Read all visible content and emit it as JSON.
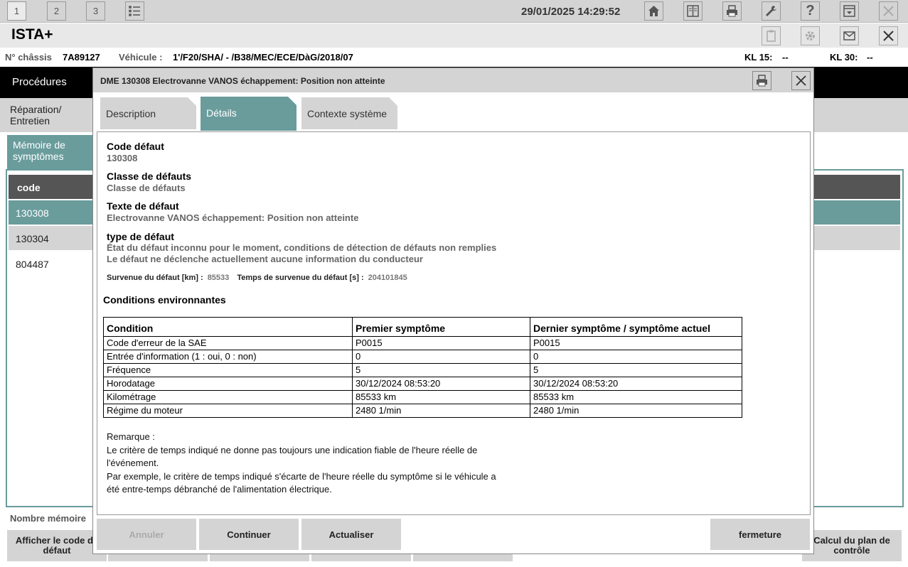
{
  "topbar": {
    "tabs": [
      "1",
      "2",
      "3"
    ],
    "datetime": "29/01/2025 14:29:52"
  },
  "app": {
    "title": "ISTA+"
  },
  "vehicle": {
    "chassis_label": "N° châssis",
    "chassis_value": "7A89127",
    "vehicle_label": "Véhicule :",
    "vehicle_value": "1'/F20/SHA/ - /B38/MEC/ECE/DàG/2018/07",
    "kl15_label": "KL 15:",
    "kl15_value": "--",
    "kl30_label": "KL 30:",
    "kl30_value": "--"
  },
  "nav": {
    "procedures": "Procédures",
    "repair": "Réparation/ Entretien",
    "memory_tab": "Mémoire de symptômes"
  },
  "list": {
    "header": "code",
    "rows": [
      "130308",
      "130304",
      "804487"
    ]
  },
  "bottom": {
    "nb_memory": "Nombre mémoire",
    "show_code": "Afficher le code de défaut",
    "calc_plan": "Calcul du plan de contrôle"
  },
  "dialog": {
    "title": "DME 130308 Electrovanne VANOS échappement: Position non atteinte",
    "tabs": {
      "description": "Description",
      "details": "Détails",
      "context": "Contexte système"
    },
    "fields": {
      "code_label": "Code défaut",
      "code_value": "130308",
      "class_label": "Classe de défauts",
      "class_value": "Classe de défauts",
      "text_label": "Texte de défaut",
      "text_value": "Electrovanne VANOS échappement: Position non atteinte",
      "type_label": "type de défaut",
      "type_line1": "État du défaut inconnu pour le moment, conditions de détection de défauts non remplies",
      "type_line2": "Le défaut ne déclenche actuellement aucune information du conducteur",
      "km_label": "Survenue du défaut [km] :",
      "km_value": "85533",
      "time_label": "Temps de survenue du défaut [s] :",
      "time_value": "204101845"
    },
    "conditions_title": "Conditions environnantes",
    "table": {
      "headers": [
        "Condition",
        "Premier symptôme",
        "Dernier symptôme / symptôme actuel"
      ],
      "rows": [
        [
          "Code d'erreur de la SAE",
          "P0015",
          "P0015"
        ],
        [
          "Entrée d'information (1 : oui, 0 : non)",
          "0",
          "0"
        ],
        [
          "Fréquence",
          "5",
          "5"
        ],
        [
          "Horodatage",
          "30/12/2024 08:53:20",
          "30/12/2024 08:53:20"
        ],
        [
          "Kilométrage",
          "85533 km",
          "85533 km"
        ],
        [
          "Régime du moteur",
          "2480 1/min",
          "2480 1/min"
        ]
      ]
    },
    "remark": {
      "title": "Remarque :",
      "line1": "Le critère de temps indiqué ne donne pas toujours une indication fiable de l'heure réelle de",
      "line2": "l'événement.",
      "line3": "Par exemple, le critère de temps indiqué s'écarte de l'heure réelle du symptôme si le véhicule a",
      "line4": "été entre-temps débranché de l'alimentation électrique."
    },
    "buttons": {
      "cancel": "Annuler",
      "continue": "Continuer",
      "refresh": "Actualiser",
      "close": "fermeture"
    }
  },
  "icons": [
    "home-icon",
    "print-icon",
    "wrench-icon",
    "help-icon",
    "close-icon",
    "gear-icon",
    "mail-icon"
  ],
  "colors": {
    "accent": "#6a9c9c",
    "header_dark": "#555555",
    "nav_black": "#000000"
  }
}
